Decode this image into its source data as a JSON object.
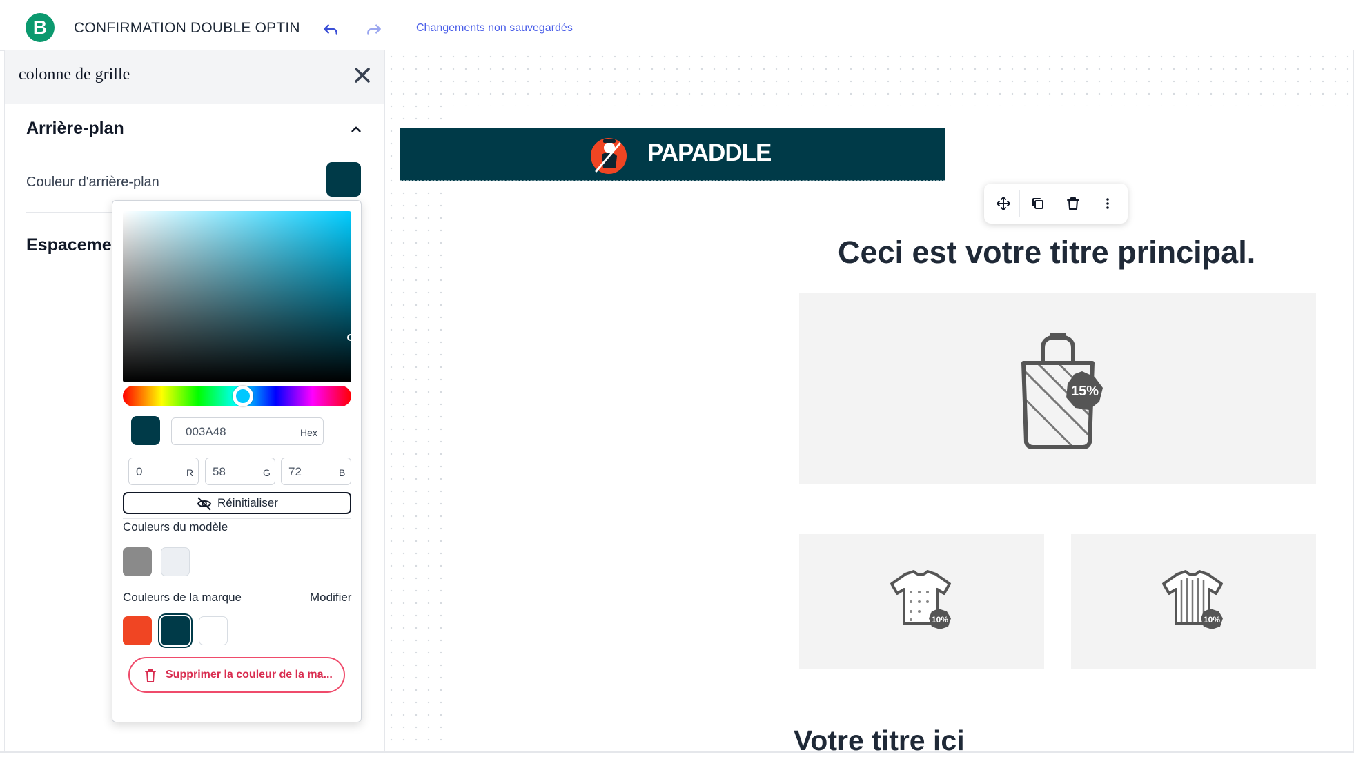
{
  "app": {
    "logo_letter": "B",
    "document_title": "CONFIRMATION DOUBLE OPTIN",
    "status": "Changements non sauvegardés",
    "undo_icon": "undo-icon",
    "redo_icon": "redo-icon"
  },
  "sidebar": {
    "title": "colonne de grille",
    "close_icon": "close-icon",
    "background_section": {
      "title": "Arrière-plan",
      "label": "Couleur d'arrière-plan",
      "value": "#003a48"
    },
    "spacing_section": {
      "title": "Espaceme"
    }
  },
  "color_picker": {
    "hex": "003A48",
    "hex_label": "Hex",
    "r": "0",
    "g": "58",
    "b": "72",
    "r_label": "R",
    "g_label": "G",
    "b_label": "B",
    "reset_label": "Réinitialiser",
    "template_colors_label": "Couleurs du modèle",
    "template_colors": [
      "#8a8a8a",
      "#eceff3"
    ],
    "brand_colors_label": "Couleurs de la marque",
    "modify_label": "Modifier",
    "brand_colors": [
      "#f04523",
      "#003a48",
      "#ffffff"
    ],
    "delete_label": "Supprimer la couleur de la ma..."
  },
  "canvas": {
    "brand_name": "PAPADDLE",
    "main_title": "Ceci est votre titre principal.",
    "discount_big": "15%",
    "discount_small": "10%",
    "secondary_title": "Votre titre ici",
    "toolbar_icons": [
      "move-icon",
      "duplicate-icon",
      "trash-icon",
      "more-icon"
    ]
  },
  "colors": {
    "accent": "#4a5ee8",
    "brand_dark": "#003a48",
    "brand_orange": "#f04523",
    "danger": "#d92d50"
  }
}
